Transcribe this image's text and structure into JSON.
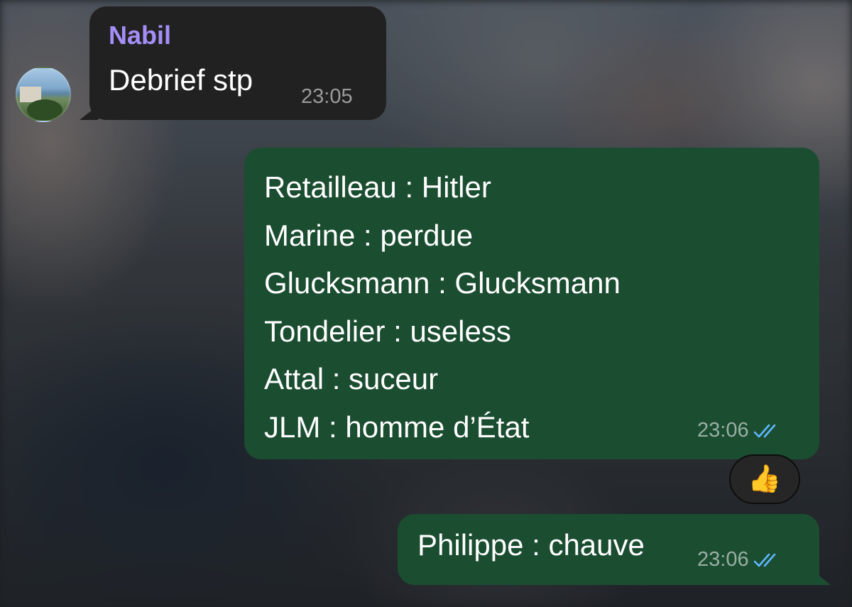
{
  "incoming": {
    "sender": "Nabil",
    "text": "Debrief stp",
    "time": "23:05"
  },
  "outgoing": [
    {
      "lines": [
        "Retailleau : Hitler",
        "Marine : perdue",
        "Glucksmann : Glucksmann",
        "Tondelier : useless",
        "Attal : suceur",
        "JLM : homme d’État"
      ],
      "time": "23:06",
      "status_icon": "double-check-icon",
      "reaction": "👍"
    },
    {
      "text": "Philippe : chauve",
      "time": "23:06",
      "status_icon": "double-check-icon"
    }
  ],
  "colors": {
    "incoming_bubble": "#212121",
    "outgoing_bubble": "#1b4d31",
    "sender_name": "#a58ef8",
    "read_ticks": "#5fb7ff"
  }
}
